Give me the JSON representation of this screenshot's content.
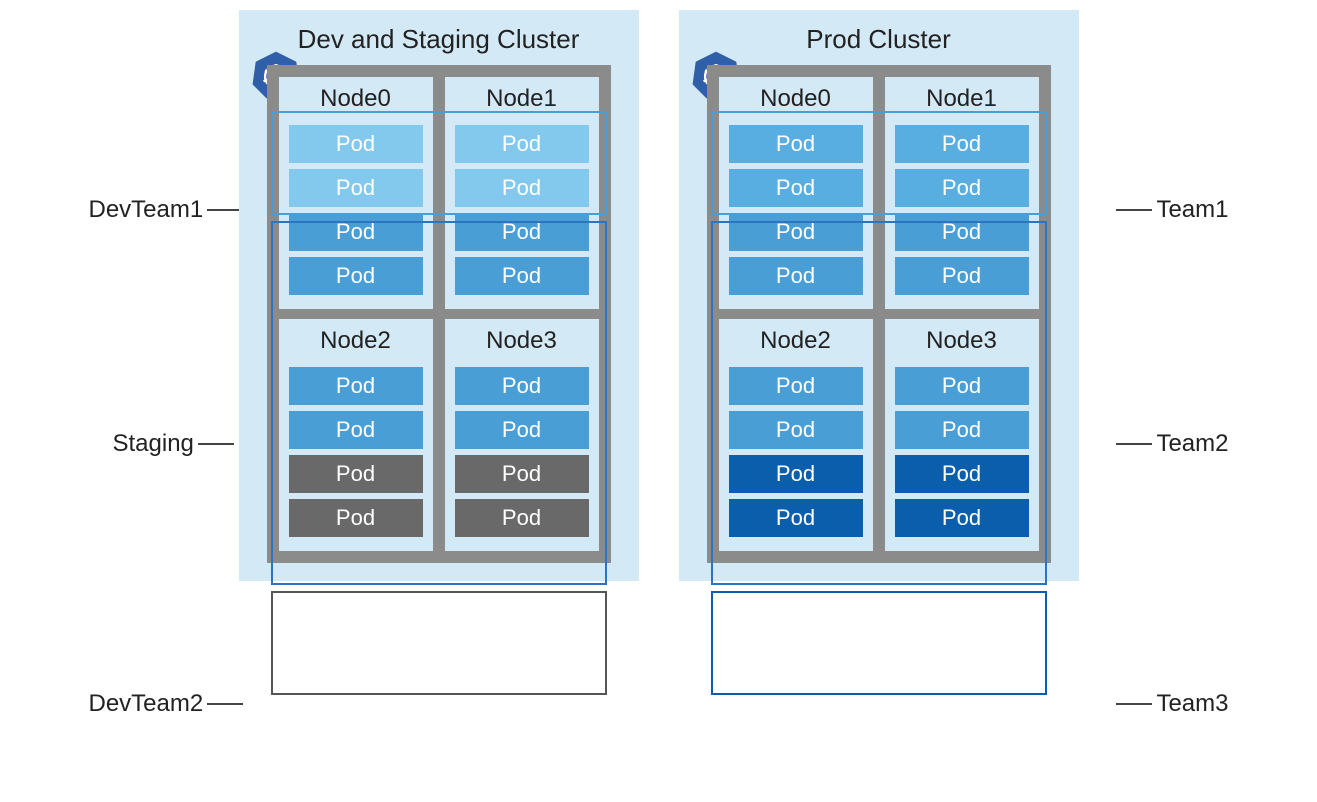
{
  "clusters": [
    {
      "title": "Dev and Staging Cluster",
      "nodes_top": [
        "Node0",
        "Node1"
      ],
      "nodes_bottom": [
        "Node2",
        "Node3"
      ],
      "pod_label": "Pod",
      "teams": [
        {
          "name": "DevTeam1",
          "color": "#4a9ed6",
          "side": "left"
        },
        {
          "name": "Staging",
          "color": "#2d74c0",
          "side": "left"
        },
        {
          "name": "DevTeam2",
          "color": "#555555",
          "side": "left"
        }
      ]
    },
    {
      "title": "Prod Cluster",
      "nodes_top": [
        "Node0",
        "Node1"
      ],
      "nodes_bottom": [
        "Node2",
        "Node3"
      ],
      "pod_label": "Pod",
      "teams": [
        {
          "name": "Team1",
          "color": "#4a9ed6",
          "side": "right"
        },
        {
          "name": "Team2",
          "color": "#2d74c0",
          "side": "right"
        },
        {
          "name": "Team3",
          "color": "#0b5eab",
          "side": "right"
        }
      ]
    }
  ],
  "icon_name": "kubernetes-icon"
}
